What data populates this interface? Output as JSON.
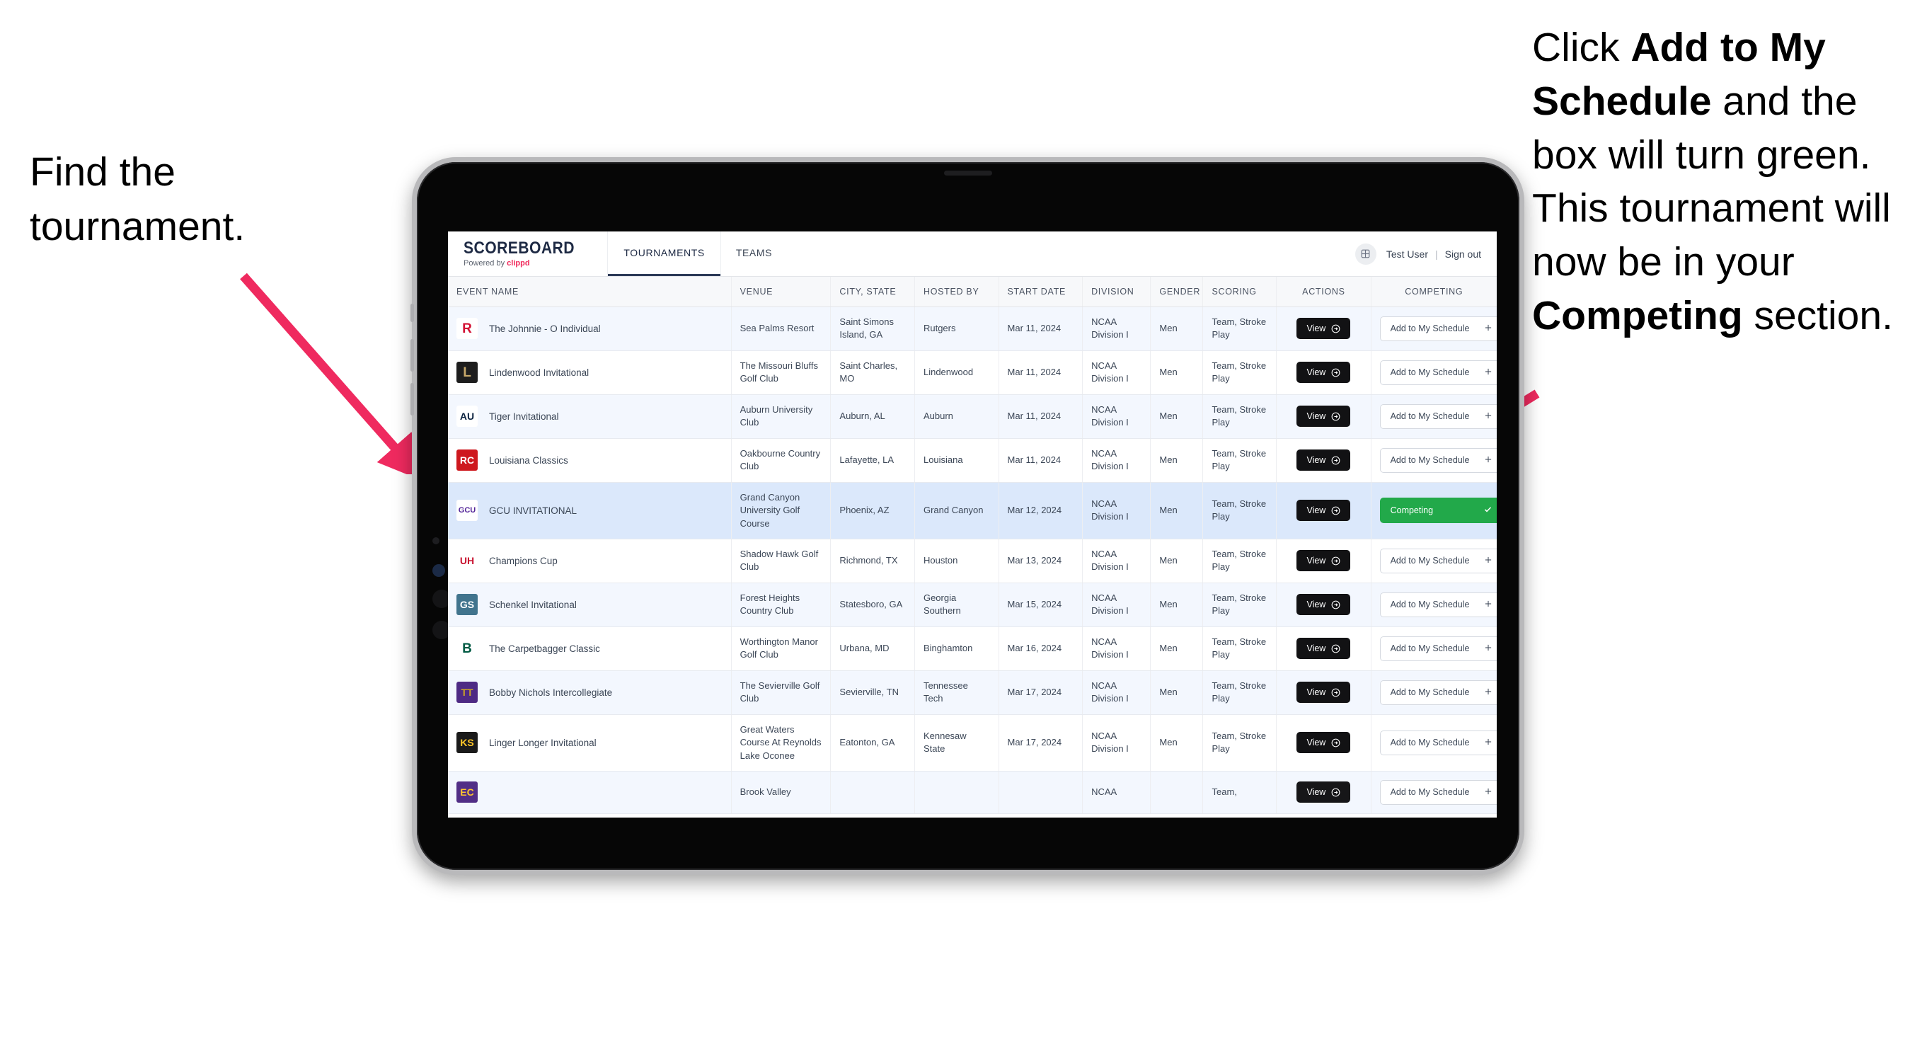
{
  "annotations": {
    "left": {
      "line1": "Find the",
      "line2": "tournament."
    },
    "right": {
      "seg1": "Click ",
      "bold1": "Add to My Schedule",
      "seg2": " and the box will turn green. This tournament will now be in your ",
      "bold2": "Competing",
      "seg3": " section."
    },
    "arrow_color": "#ef2a5f"
  },
  "app": {
    "brand": {
      "name": "SCOREBOARD",
      "powered_prefix": "Powered by ",
      "powered_brand": "clippd"
    },
    "tabs": [
      {
        "label": "TOURNAMENTS",
        "active": true
      },
      {
        "label": "TEAMS",
        "active": false
      }
    ],
    "header_right": {
      "grid_icon": "grid-icon",
      "user": "Test User",
      "separator": "|",
      "sign_out": "Sign out"
    },
    "table": {
      "columns": [
        "EVENT NAME",
        "VENUE",
        "CITY, STATE",
        "HOSTED BY",
        "START DATE",
        "DIVISION",
        "GENDER",
        "SCORING",
        "ACTIONS",
        "COMPETING"
      ],
      "action_label": "View",
      "add_label": "Add to My Schedule",
      "add_icon": "plus-icon",
      "competing_label": "Competing",
      "competing_icon": "check-icon",
      "competing_color": "#22a94a",
      "rows": [
        {
          "logo": "R",
          "logo_fg": "#d21033",
          "logo_bg": "#ffffff",
          "event": "The Johnnie - O Individual",
          "venue": "Sea Palms Resort",
          "city": "Saint Simons Island, GA",
          "host": "Rutgers",
          "date": "Mar 11, 2024",
          "division": "NCAA Division I",
          "gender": "Men",
          "scoring": "Team, Stroke Play",
          "competing": false
        },
        {
          "logo": "L",
          "logo_fg": "#c8a96a",
          "logo_bg": "#1d1d1d",
          "event": "Lindenwood Invitational",
          "venue": "The Missouri Bluffs Golf Club",
          "city": "Saint Charles, MO",
          "host": "Lindenwood",
          "date": "Mar 11, 2024",
          "division": "NCAA Division I",
          "gender": "Men",
          "scoring": "Team, Stroke Play",
          "competing": false
        },
        {
          "logo": "AU",
          "logo_fg": "#0c2340",
          "logo_bg": "#ffffff",
          "event": "Tiger Invitational",
          "venue": "Auburn University Club",
          "city": "Auburn, AL",
          "host": "Auburn",
          "date": "Mar 11, 2024",
          "division": "NCAA Division I",
          "gender": "Men",
          "scoring": "Team, Stroke Play",
          "competing": false
        },
        {
          "logo": "RC",
          "logo_fg": "#ffffff",
          "logo_bg": "#ce181e",
          "event": "Louisiana Classics",
          "venue": "Oakbourne Country Club",
          "city": "Lafayette, LA",
          "host": "Louisiana",
          "date": "Mar 11, 2024",
          "division": "NCAA Division I",
          "gender": "Men",
          "scoring": "Team, Stroke Play",
          "competing": false
        },
        {
          "logo": "GCU",
          "logo_fg": "#522398",
          "logo_bg": "#ffffff",
          "event": "GCU INVITATIONAL",
          "venue": "Grand Canyon University Golf Course",
          "city": "Phoenix, AZ",
          "host": "Grand Canyon",
          "date": "Mar 12, 2024",
          "division": "NCAA Division I",
          "gender": "Men",
          "scoring": "Team, Stroke Play",
          "competing": true,
          "highlighted": true
        },
        {
          "logo": "UH",
          "logo_fg": "#c8102e",
          "logo_bg": "#ffffff",
          "event": "Champions Cup",
          "venue": "Shadow Hawk Golf Club",
          "city": "Richmond, TX",
          "host": "Houston",
          "date": "Mar 13, 2024",
          "division": "NCAA Division I",
          "gender": "Men",
          "scoring": "Team, Stroke Play",
          "competing": false
        },
        {
          "logo": "GS",
          "logo_fg": "#ffffff",
          "logo_bg": "#41748d",
          "event": "Schenkel Invitational",
          "venue": "Forest Heights Country Club",
          "city": "Statesboro, GA",
          "host": "Georgia Southern",
          "date": "Mar 15, 2024",
          "division": "NCAA Division I",
          "gender": "Men",
          "scoring": "Team, Stroke Play",
          "competing": false
        },
        {
          "logo": "B",
          "logo_fg": "#005a43",
          "logo_bg": "#ffffff",
          "event": "The Carpetbagger Classic",
          "venue": "Worthington Manor Golf Club",
          "city": "Urbana, MD",
          "host": "Binghamton",
          "date": "Mar 16, 2024",
          "division": "NCAA Division I",
          "gender": "Men",
          "scoring": "Team, Stroke Play",
          "competing": false
        },
        {
          "logo": "TT",
          "logo_fg": "#c9a227",
          "logo_bg": "#4e2a84",
          "event": "Bobby Nichols Intercollegiate",
          "venue": "The Sevierville Golf Club",
          "city": "Sevierville, TN",
          "host": "Tennessee Tech",
          "date": "Mar 17, 2024",
          "division": "NCAA Division I",
          "gender": "Men",
          "scoring": "Team, Stroke Play",
          "competing": false
        },
        {
          "logo": "KS",
          "logo_fg": "#ffc629",
          "logo_bg": "#1a1a1a",
          "event": "Linger Longer Invitational",
          "venue": "Great Waters Course At Reynolds Lake Oconee",
          "city": "Eatonton, GA",
          "host": "Kennesaw State",
          "date": "Mar 17, 2024",
          "division": "NCAA Division I",
          "gender": "Men",
          "scoring": "Team, Stroke Play",
          "competing": false
        },
        {
          "logo": "EC",
          "logo_fg": "#ffc629",
          "logo_bg": "#4e2a84",
          "event": "",
          "venue": "Brook Valley",
          "city": "",
          "host": "",
          "date": "",
          "division": "NCAA",
          "gender": "",
          "scoring": "Team,",
          "competing": false,
          "partial": true
        }
      ]
    }
  }
}
